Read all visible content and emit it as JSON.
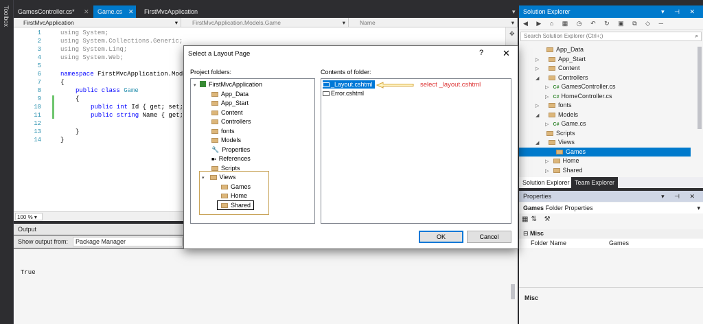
{
  "toolbox": {
    "label": "Toolbox"
  },
  "tabs": [
    {
      "label": "GamesController.cs*"
    },
    {
      "label": "Game.cs"
    },
    {
      "label": "FirstMvcApplication"
    }
  ],
  "navbar": {
    "project": "FirstMvcApplication",
    "type": "FirstMvcApplication.Models.Game",
    "member": "Name"
  },
  "editor": {
    "line_numbers": [
      "1",
      "2",
      "3",
      "4",
      "5",
      "6",
      "7",
      "8",
      "9",
      "10",
      "11",
      "12",
      "13",
      "14"
    ],
    "lines": {
      "l1": "using System;",
      "l2": "using System.Collections.Generic;",
      "l3": "using System.Linq;",
      "l4": "using System.Web;",
      "l6a": "namespace",
      "l6b": " FirstMvcApplication.Mode",
      "l7": "{",
      "l8a": "public class",
      "l8b": "Game",
      "l9": "{",
      "l10a": "public int",
      "l10b": " Id { get; set;",
      "l11a": "public string",
      "l11b": " Name { get;",
      "l13": "}",
      "l14": "}"
    }
  },
  "zoom": "100 %",
  "output": {
    "title": "Output",
    "show_from_label": "Show output from:",
    "source": "Package Manager",
    "text": "True"
  },
  "solution_explorer": {
    "title": "Solution Explorer",
    "search_placeholder": "Search Solution Explorer (Ctrl+;)",
    "items": [
      {
        "label": "App_Data"
      },
      {
        "label": "App_Start"
      },
      {
        "label": "Content"
      },
      {
        "label": "Controllers"
      },
      {
        "label": "GamesController.cs"
      },
      {
        "label": "HomeController.cs"
      },
      {
        "label": "fonts"
      },
      {
        "label": "Models"
      },
      {
        "label": "Game.cs"
      },
      {
        "label": "Scripts"
      },
      {
        "label": "Views"
      },
      {
        "label": "Games"
      },
      {
        "label": "Home"
      },
      {
        "label": "Shared"
      }
    ],
    "tab_solution": "Solution Explorer",
    "tab_team": "Team Explorer"
  },
  "properties": {
    "title": "Properties",
    "object": "Games",
    "object_type": "Folder Properties",
    "section": "Misc",
    "prop_name": "Folder Name",
    "prop_value": "Games",
    "footer": "Misc"
  },
  "dialog": {
    "title": "Select a Layout Page",
    "help": "?",
    "close": "✕",
    "project_folders_label": "Project folders:",
    "contents_label": "Contents of folder:",
    "tree": [
      {
        "label": "FirstMvcApplication"
      },
      {
        "label": "App_Data"
      },
      {
        "label": "App_Start"
      },
      {
        "label": "Content"
      },
      {
        "label": "Controllers"
      },
      {
        "label": "fonts"
      },
      {
        "label": "Models"
      },
      {
        "label": "Properties"
      },
      {
        "label": "References"
      },
      {
        "label": "Scripts"
      },
      {
        "label": "Views"
      },
      {
        "label": "Games"
      },
      {
        "label": "Home"
      },
      {
        "label": "Shared"
      }
    ],
    "files": [
      {
        "label": "_Layout.cshtml"
      },
      {
        "label": "Error.cshtml"
      }
    ],
    "annotation": "select _layout.cshtml",
    "ok": "OK",
    "cancel": "Cancel"
  }
}
